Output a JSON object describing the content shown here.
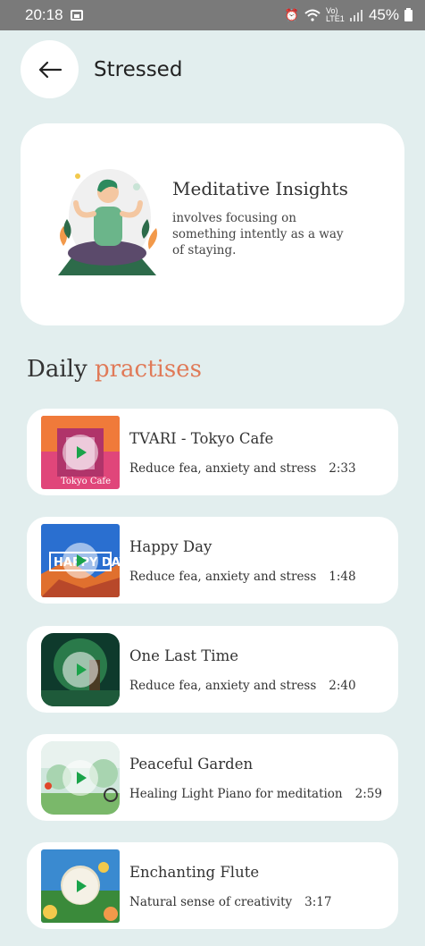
{
  "status_bar": {
    "time": "20:18",
    "network": "Vo) LTE1",
    "battery": "45%"
  },
  "header": {
    "title": "Stressed"
  },
  "insight": {
    "title": "Meditative Insights",
    "description": "involves focusing on something intently as a way of staying."
  },
  "section": {
    "title_plain": "Daily",
    "title_accent": "practises",
    "accent_color": "#e07a58"
  },
  "tracks": [
    {
      "title": "TVARI - Tokyo Cafe",
      "subtitle": "Reduce fea, anxiety and stress",
      "duration": "2:33"
    },
    {
      "title": "Happy Day",
      "subtitle": "Reduce fea, anxiety and stress",
      "duration": "1:48"
    },
    {
      "title": "One Last Time",
      "subtitle": "Reduce fea, anxiety and stress",
      "duration": "2:40"
    },
    {
      "title": "Peaceful Garden",
      "subtitle": "Healing Light Piano for meditation",
      "duration": "2:59"
    },
    {
      "title": "Enchanting Flute",
      "subtitle": "Natural sense of creativity",
      "duration": "3:17"
    }
  ],
  "icons": {
    "back": "arrow-left-icon",
    "play": "play-icon"
  }
}
